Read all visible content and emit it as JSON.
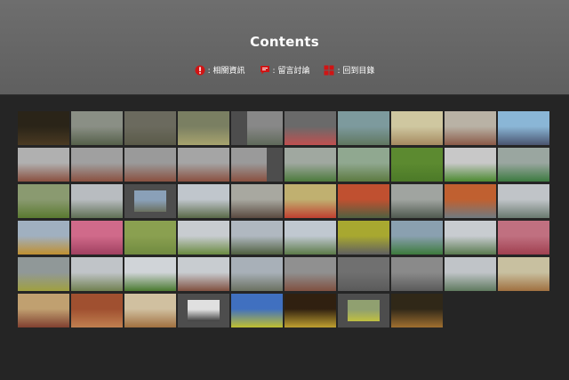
{
  "header": {
    "title": "Contents",
    "legend": [
      {
        "label": ": 相關資訊",
        "icon": "info-icon",
        "color": "#d01414"
      },
      {
        "label": ": 留言討論",
        "icon": "comment-icon",
        "color": "#d01414"
      },
      {
        "label": ": 回到目錄",
        "icon": "grid-icon",
        "color": "#d01414"
      }
    ]
  },
  "thumbnails": [
    {
      "layout": "full",
      "colors": [
        "#2a2418",
        "#4a3a22"
      ]
    },
    {
      "layout": "full",
      "colors": [
        "#8a8f85",
        "#55604a"
      ]
    },
    {
      "layout": "full",
      "colors": [
        "#6b6a5e",
        "#5a5a48"
      ]
    },
    {
      "layout": "full",
      "colors": [
        "#7a7f62",
        "#a8a46e"
      ]
    },
    {
      "layout": "rs",
      "colors": [
        "#888",
        "#5f6a5a"
      ]
    },
    {
      "layout": "full",
      "colors": [
        "#6a6a6a",
        "#c05050"
      ]
    },
    {
      "layout": "full",
      "colors": [
        "#7d9a9d",
        "#607760"
      ]
    },
    {
      "layout": "full",
      "colors": [
        "#cfc7a0",
        "#a58a60"
      ]
    },
    {
      "layout": "full",
      "colors": [
        "#b9b2a5",
        "#8a5a48"
      ]
    },
    {
      "layout": "full",
      "colors": [
        "#8ab6d6",
        "#4a5570"
      ]
    },
    {
      "layout": "full",
      "colors": [
        "#b0b0b0",
        "#8a5040"
      ]
    },
    {
      "layout": "full",
      "colors": [
        "#a0a0a0",
        "#8a5040"
      ]
    },
    {
      "layout": "full",
      "colors": [
        "#9a9a9a",
        "#8a5040"
      ]
    },
    {
      "layout": "full",
      "colors": [
        "#a5a5a5",
        "#8a5040"
      ]
    },
    {
      "layout": "ls",
      "colors": [
        "#9a9a9a",
        "#8a5040"
      ]
    },
    {
      "layout": "full",
      "colors": [
        "#a0a8a0",
        "#4c7a3c"
      ]
    },
    {
      "layout": "full",
      "colors": [
        "#90a890",
        "#5c7a40"
      ]
    },
    {
      "layout": "full",
      "colors": [
        "#5c8a30",
        "#4c7a28"
      ]
    },
    {
      "layout": "full",
      "colors": [
        "#c8c8c8",
        "#4c8a30"
      ]
    },
    {
      "layout": "full",
      "colors": [
        "#9aa6a0",
        "#3c7a40"
      ]
    },
    {
      "layout": "full",
      "colors": [
        "#8a9a70",
        "#5a7a30"
      ]
    },
    {
      "layout": "full",
      "colors": [
        "#b8bcc0",
        "#607055"
      ]
    },
    {
      "layout": "mid",
      "colors": [
        "#8aa0b8",
        "#6a7060"
      ]
    },
    {
      "layout": "full",
      "colors": [
        "#c0c6cc",
        "#5a6a48"
      ]
    },
    {
      "layout": "full",
      "colors": [
        "#a8a8a0",
        "#5a4a40"
      ]
    },
    {
      "layout": "full",
      "colors": [
        "#c0b070",
        "#c04030"
      ]
    },
    {
      "layout": "full",
      "colors": [
        "#c05030",
        "#506040"
      ]
    },
    {
      "layout": "full",
      "colors": [
        "#a0a4a0",
        "#505a50"
      ]
    },
    {
      "layout": "full",
      "colors": [
        "#c06030",
        "#707a80"
      ]
    },
    {
      "layout": "full",
      "colors": [
        "#c0c4c8",
        "#6a7a70"
      ]
    },
    {
      "layout": "full",
      "colors": [
        "#a0b0c0",
        "#c09030"
      ]
    },
    {
      "layout": "full",
      "colors": [
        "#d06a8a",
        "#a04060"
      ]
    },
    {
      "layout": "full",
      "colors": [
        "#8aa050",
        "#708a40"
      ]
    },
    {
      "layout": "full",
      "colors": [
        "#c8ccd0",
        "#6a8a40"
      ]
    },
    {
      "layout": "full",
      "colors": [
        "#b0b8c0",
        "#506040"
      ]
    },
    {
      "layout": "full",
      "colors": [
        "#c0c8d0",
        "#5c7a48"
      ]
    },
    {
      "layout": "full",
      "colors": [
        "#a8a830",
        "#606060"
      ]
    },
    {
      "layout": "full",
      "colors": [
        "#8aa0b0",
        "#3c7a3c"
      ]
    },
    {
      "layout": "full",
      "colors": [
        "#c8ccd0",
        "#5a7a50"
      ]
    },
    {
      "layout": "full",
      "colors": [
        "#c07080",
        "#a04050"
      ]
    },
    {
      "layout": "full",
      "colors": [
        "#909898",
        "#a0a040"
      ]
    },
    {
      "layout": "full",
      "colors": [
        "#c0c4c8",
        "#708050"
      ]
    },
    {
      "layout": "full",
      "colors": [
        "#d0d4d8",
        "#4a7a30"
      ]
    },
    {
      "layout": "full",
      "colors": [
        "#c8ccd0",
        "#805040"
      ]
    },
    {
      "layout": "full",
      "colors": [
        "#a8b0b8",
        "#6a7060"
      ]
    },
    {
      "layout": "full",
      "colors": [
        "#909090",
        "#805040"
      ]
    },
    {
      "layout": "full",
      "colors": [
        "#707070",
        "#5a5a5a"
      ]
    },
    {
      "layout": "full",
      "colors": [
        "#8a8a8a",
        "#5a5a5a"
      ]
    },
    {
      "layout": "full",
      "colors": [
        "#c0c4c8",
        "#607a60"
      ]
    },
    {
      "layout": "full",
      "colors": [
        "#c8c0a0",
        "#a07040"
      ]
    },
    {
      "layout": "full",
      "colors": [
        "#c0a070",
        "#804030"
      ]
    },
    {
      "layout": "full",
      "colors": [
        "#a05030",
        "#c08050"
      ]
    },
    {
      "layout": "full",
      "colors": [
        "#d0c0a0",
        "#a07040"
      ]
    },
    {
      "layout": "mid",
      "colors": [
        "#e0e0e0",
        "#404040"
      ]
    },
    {
      "layout": "full",
      "colors": [
        "#4070c0",
        "#c0c030"
      ]
    },
    {
      "layout": "full",
      "colors": [
        "#302010",
        "#c0a030"
      ]
    },
    {
      "layout": "mid",
      "colors": [
        "#90a070",
        "#c0c040"
      ]
    },
    {
      "layout": "full",
      "colors": [
        "#302818",
        "#a07030"
      ]
    }
  ]
}
